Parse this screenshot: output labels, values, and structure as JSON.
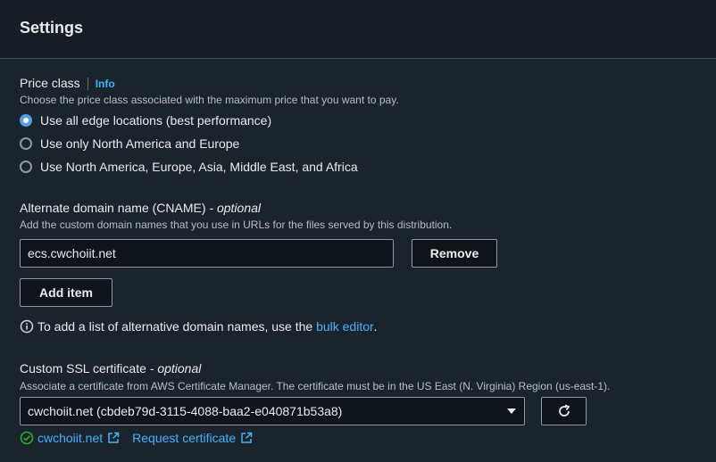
{
  "header": {
    "title": "Settings"
  },
  "price_class": {
    "label": "Price class",
    "info": "Info",
    "description": "Choose the price class associated with the maximum price that you want to pay.",
    "options": [
      {
        "label": "Use all edge locations (best performance)",
        "selected": true
      },
      {
        "label": "Use only North America and Europe",
        "selected": false
      },
      {
        "label": "Use North America, Europe, Asia, Middle East, and Africa",
        "selected": false
      }
    ]
  },
  "cname": {
    "label": "Alternate domain name (CNAME)",
    "optional": "- optional",
    "description": "Add the custom domain names that you use in URLs for the files served by this distribution.",
    "value": "ecs.cwchoiit.net",
    "remove_label": "Remove",
    "add_label": "Add item",
    "hint_text": "To add a list of alternative domain names, use the",
    "hint_link": "bulk editor",
    "hint_end": "."
  },
  "ssl": {
    "label": "Custom SSL certificate",
    "optional": "- optional",
    "description": "Associate a certificate from AWS Certificate Manager. The certificate must be in the US East (N. Virginia) Region (us-east-1).",
    "selected": "cwchoiit.net (cbdeb79d-3115-4088-baa2-e040871b53a8)",
    "status_link": "cwchoiit.net",
    "request_link": "Request certificate"
  },
  "colors": {
    "accent": "#42b4ff",
    "success": "#29ad32",
    "radio": "#539fe5"
  }
}
